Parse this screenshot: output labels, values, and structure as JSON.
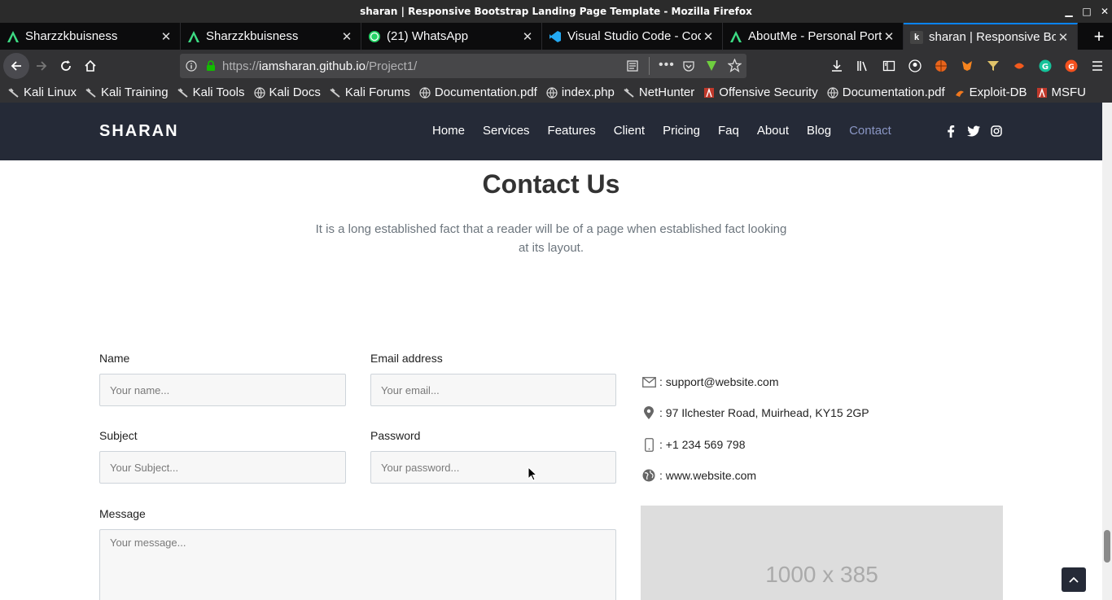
{
  "window": {
    "title": "sharan | Responsive Bootstrap Landing Page Template - Mozilla Firefox"
  },
  "tabs": [
    {
      "label": "Sharzzkbuisness",
      "icon": "android-studio-icon"
    },
    {
      "label": "Sharzzkbuisness",
      "icon": "android-studio-icon"
    },
    {
      "label": "(21) WhatsApp",
      "icon": "whatsapp-icon"
    },
    {
      "label": "Visual Studio Code - Cod",
      "icon": "vscode-icon"
    },
    {
      "label": "AboutMe - Personal Port",
      "icon": "android-studio-icon"
    },
    {
      "label": "sharan | Responsive Boo",
      "icon": "k-icon"
    }
  ],
  "url": {
    "prefix": "https://",
    "domain": "iamsharan.github.io",
    "path": "/Project1/"
  },
  "bookmarks": [
    "Kali Linux",
    "Kali Training",
    "Kali Tools",
    "Kali Docs",
    "Kali Forums",
    "Documentation.pdf",
    "index.php",
    "NetHunter",
    "Offensive Security",
    "Documentation.pdf",
    "Exploit-DB",
    "MSFU"
  ],
  "site": {
    "brand": "SHARAN",
    "menu": [
      "Home",
      "Services",
      "Features",
      "Client",
      "Pricing",
      "Faq",
      "About",
      "Blog",
      "Contact"
    ],
    "active_menu": "Contact"
  },
  "contact": {
    "title": "Contact Us",
    "description": "It is a long established fact that a reader will be of a page when established fact looking at its layout.",
    "form": {
      "name_label": "Name",
      "name_placeholder": "Your name...",
      "email_label": "Email address",
      "email_placeholder": "Your email...",
      "subject_label": "Subject",
      "subject_placeholder": "Your Subject...",
      "password_label": "Password",
      "password_placeholder": "Your password...",
      "message_label": "Message",
      "message_placeholder": "Your message..."
    },
    "info": {
      "email": ": support@website.com",
      "address": ": 97 Ilchester Road, Muirhead, KY15 2GP",
      "phone": ": +1 234 569 798",
      "website": ": www.website.com"
    },
    "map_placeholder": "1000 x 385"
  },
  "colors": {
    "nav_bg": "#252a37",
    "active_link": "#8a96c4",
    "tab_accent": "#0a84ff"
  }
}
